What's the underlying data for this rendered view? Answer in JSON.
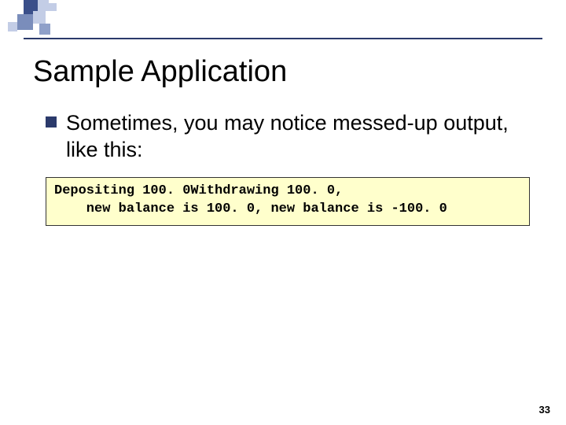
{
  "slide": {
    "title": "Sample Application",
    "bullet_text": "Sometimes, you may notice messed-up output, like this:",
    "code_line1": "Depositing 100. 0Withdrawing 100. 0,",
    "code_line2": "    new balance is 100. 0, new balance is -100. 0",
    "page_number": "33"
  }
}
